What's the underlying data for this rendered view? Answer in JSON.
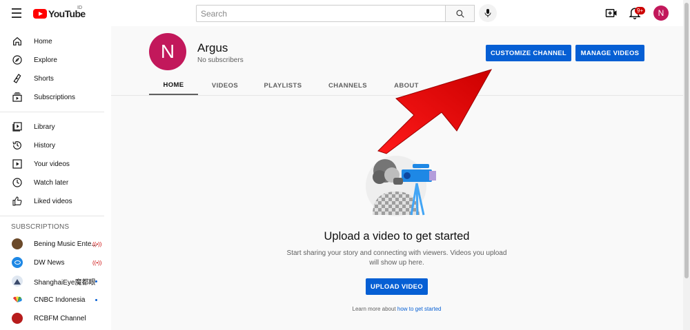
{
  "header": {
    "logo_text": "YouTube",
    "region": "ID",
    "search_placeholder": "Search",
    "notification_count": "9+",
    "account_initial": "N"
  },
  "sidebar": {
    "primary": [
      {
        "label": "Home",
        "icon": "home-icon"
      },
      {
        "label": "Explore",
        "icon": "compass-icon"
      },
      {
        "label": "Shorts",
        "icon": "shorts-icon"
      },
      {
        "label": "Subscriptions",
        "icon": "subscriptions-icon"
      }
    ],
    "library": [
      {
        "label": "Library",
        "icon": "library-icon"
      },
      {
        "label": "History",
        "icon": "history-icon"
      },
      {
        "label": "Your videos",
        "icon": "play-square-icon"
      },
      {
        "label": "Watch later",
        "icon": "clock-icon"
      },
      {
        "label": "Liked videos",
        "icon": "thumb-up-icon"
      }
    ],
    "subscriptions_heading": "SUBSCRIPTIONS",
    "subscriptions": [
      {
        "label": "Bening Music Ente...",
        "status": "live",
        "avatar_color": "#6b4a2a"
      },
      {
        "label": "DW News",
        "status": "live",
        "avatar_color": "#1e88e5"
      },
      {
        "label": "ShanghaiEye魔都眼",
        "status": "new",
        "avatar_color": "#3b4a6b"
      },
      {
        "label": "CNBC Indonesia",
        "status": "new",
        "avatar_color": "#ffffff"
      },
      {
        "label": "RCBFM Channel",
        "status": "",
        "avatar_color": "#b71c1c"
      }
    ],
    "live_glyph": "((•))"
  },
  "channel": {
    "avatar_initial": "N",
    "name": "Argus",
    "subscribers": "No subscribers",
    "customize_label": "CUSTOMIZE CHANNEL",
    "manage_label": "MANAGE VIDEOS",
    "tabs": [
      "HOME",
      "VIDEOS",
      "PLAYLISTS",
      "CHANNELS",
      "ABOUT"
    ],
    "active_tab": "HOME"
  },
  "empty_state": {
    "title": "Upload a video to get started",
    "description": "Start sharing your story and connecting with viewers. Videos you upload will show up here.",
    "upload_label": "UPLOAD VIDEO",
    "learn_prefix": "Learn more about",
    "learn_link": "how to get started"
  },
  "colors": {
    "brand_red": "#ff0000",
    "accent_blue": "#065fd4",
    "avatar": "#c2185b",
    "annotation_arrow": "#ff0000"
  }
}
